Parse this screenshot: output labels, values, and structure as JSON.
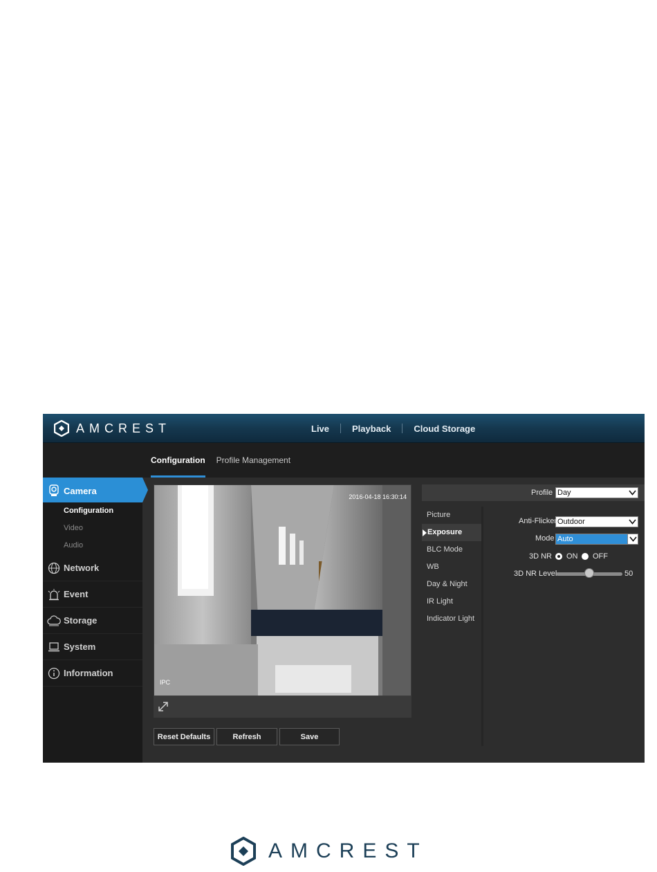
{
  "header": {
    "brand": "AMCREST",
    "nav": [
      {
        "label": "Live"
      },
      {
        "label": "Playback"
      },
      {
        "label": "Cloud Storage"
      }
    ]
  },
  "subtabs": [
    {
      "label": "Configuration",
      "active": true
    },
    {
      "label": "Profile Management",
      "active": false
    }
  ],
  "sidebar": {
    "items": [
      {
        "label": "Camera",
        "icon": "camera-icon",
        "active": true
      },
      {
        "label": "Network",
        "icon": "network-globe-icon"
      },
      {
        "label": "Event",
        "icon": "alarm-icon"
      },
      {
        "label": "Storage",
        "icon": "cloud-icon"
      },
      {
        "label": "System",
        "icon": "laptop-icon"
      },
      {
        "label": "Information",
        "icon": "info-icon"
      }
    ],
    "camera_sub": [
      {
        "label": "Configuration",
        "active": true
      },
      {
        "label": "Video"
      },
      {
        "label": "Audio"
      }
    ]
  },
  "preview": {
    "timestamp": "2016-04-18 16:30:14",
    "channel_name": "IPC"
  },
  "buttons": {
    "reset": "Reset Defaults",
    "refresh": "Refresh",
    "save": "Save"
  },
  "settings": {
    "profile_label": "Profile",
    "profile_value": "Day",
    "menu": [
      {
        "label": "Picture"
      },
      {
        "label": "Exposure",
        "active": true
      },
      {
        "label": "BLC Mode"
      },
      {
        "label": "WB"
      },
      {
        "label": "Day & Night"
      },
      {
        "label": "IR Light"
      },
      {
        "label": "Indicator Light"
      }
    ],
    "anti_flicker_label": "Anti-Flicker",
    "anti_flicker_value": "Outdoor",
    "mode_label": "Mode",
    "mode_value": "Auto",
    "nr3d_label": "3D NR",
    "nr3d_on": "ON",
    "nr3d_off": "OFF",
    "nr3d_selected": "ON",
    "nr3d_level_label": "3D NR Level",
    "nr3d_level_value": "50",
    "nr3d_level_max": 100
  },
  "footer": {
    "brand": "AMCREST"
  },
  "colors": {
    "accent": "#2b8fd6",
    "topbar": "#15384f",
    "panel": "#2d2d2d",
    "sidebar": "#1a1a1a",
    "brand_dark": "#1c3f57"
  }
}
